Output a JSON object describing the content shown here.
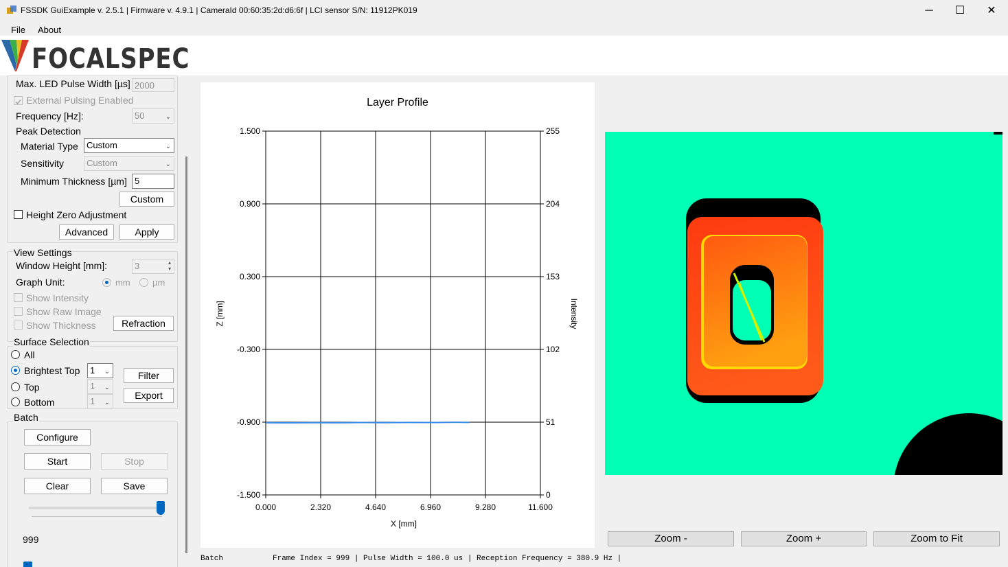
{
  "window": {
    "title": "FSSDK GuiExample v. 2.5.1 | Firmware v. 4.9.1 | CameraId 00:60:35:2d:d6:6f | LCI sensor S/N: 11912PK019",
    "minimize": "─",
    "maximize": "☐",
    "close": "✕"
  },
  "menu": {
    "file": "File",
    "about": "About"
  },
  "logo": {
    "text": "FOCALSPEC"
  },
  "settings": {
    "max_led_label": "Max. LED Pulse Width [µs]",
    "max_led_value": "2000",
    "external_pulsing": "External Pulsing Enabled",
    "frequency_label": "Frequency [Hz]:",
    "frequency_value": "50",
    "peak_detection": "Peak Detection",
    "material_type_label": "Material Type",
    "material_type_value": "Custom",
    "sensitivity_label": "Sensitivity",
    "sensitivity_value": "Custom",
    "min_thickness_label": "Minimum Thickness [µm]",
    "min_thickness_value": "5",
    "custom_button": "Custom",
    "height_zero": "Height Zero Adjustment",
    "advanced_button": "Advanced",
    "apply_button": "Apply"
  },
  "view_settings": {
    "title": "View Settings",
    "window_height_label": "Window Height [mm]:",
    "window_height_value": "3",
    "graph_unit_label": "Graph Unit:",
    "unit_mm": "mm",
    "unit_um": "µm",
    "show_intensity": "Show Intensity",
    "show_raw_image": "Show Raw Image",
    "show_thickness": "Show Thickness",
    "refraction_button": "Refraction"
  },
  "surface_selection": {
    "title": "Surface Selection",
    "all": "All",
    "brightest_top": "Brightest Top",
    "brightest_top_value": "1",
    "top": "Top",
    "top_value": "1",
    "bottom": "Bottom",
    "bottom_value": "1",
    "filter_button": "Filter",
    "export_button": "Export"
  },
  "batch": {
    "title": "Batch",
    "configure_button": "Configure",
    "start_button": "Start",
    "stop_button": "Stop",
    "clear_button": "Clear",
    "save_button": "Save",
    "slider_level": 1.0,
    "frame_value": "999"
  },
  "chart_data": {
    "type": "line",
    "title": "Layer Profile",
    "xlabel": "X [mm]",
    "ylabel": "Z [mm]",
    "y2label": "Intensity",
    "xlim": [
      0,
      11.6
    ],
    "ylim": [
      -1.5,
      1.5
    ],
    "y2lim": [
      0,
      255
    ],
    "x_ticks": [
      "0.000",
      "2.320",
      "4.640",
      "6.960",
      "9.280",
      "11.600"
    ],
    "y_ticks": [
      "1.500",
      "0.900",
      "0.300",
      "-0.300",
      "-0.900",
      "-1.500"
    ],
    "y2_ticks": [
      "255",
      "204",
      "153",
      "102",
      "51",
      "0"
    ],
    "grid": true,
    "series": [
      {
        "color": "#3c8ce6",
        "x": [
          0,
          1,
          2,
          3,
          4,
          5,
          6,
          7,
          8,
          8.6
        ],
        "y": [
          -0.905,
          -0.906,
          -0.904,
          -0.905,
          -0.903,
          -0.904,
          -0.902,
          -0.903,
          -0.901,
          -0.902
        ]
      }
    ]
  },
  "zoom": {
    "zoom_out": "Zoom -",
    "zoom_in": "Zoom +",
    "zoom_fit": "Zoom to Fit"
  },
  "status": {
    "mode": "Batch",
    "info": "Frame Index = 999 | Pulse Width = 100.0 us | Reception Frequency = 380.9 Hz |"
  }
}
